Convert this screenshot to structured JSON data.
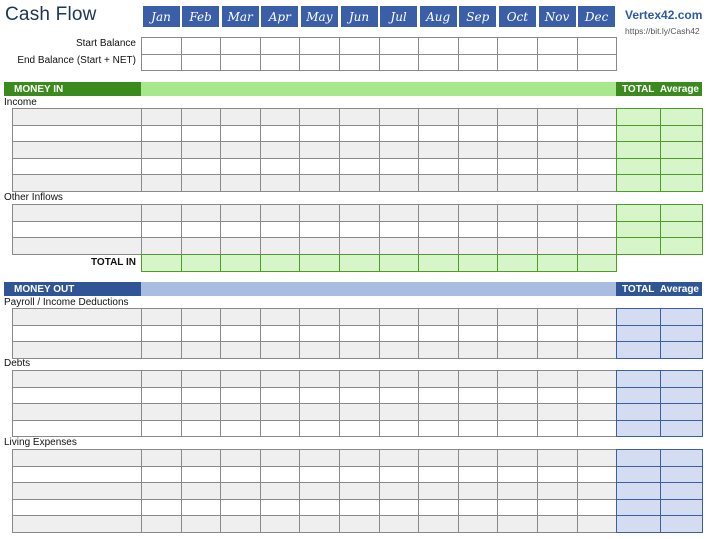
{
  "header": {
    "title": "Cash Flow",
    "months": [
      "Jan",
      "Feb",
      "Mar",
      "Apr",
      "May",
      "Jun",
      "Jul",
      "Aug",
      "Sep",
      "Oct",
      "Nov",
      "Dec"
    ],
    "brand": "Vertex42.com",
    "url": "https://bit.ly/Cash42"
  },
  "balances": {
    "start_label": "Start Balance",
    "end_label": "End Balance (Start + NET)"
  },
  "money_in": {
    "band_label": "MONEY IN",
    "total_label": "TOTAL",
    "average_label": "Average",
    "sections": [
      {
        "label": "Income",
        "rows": 5
      },
      {
        "label": "Other Inflows",
        "rows": 3
      }
    ],
    "total_in_label": "TOTAL IN"
  },
  "money_out": {
    "band_label": "MONEY OUT",
    "total_label": "TOTAL",
    "average_label": "Average",
    "sections": [
      {
        "label": "Payroll / Income Deductions",
        "rows": 3
      },
      {
        "label": "Debts",
        "rows": 4
      },
      {
        "label": "Living Expenses",
        "rows": 5
      }
    ]
  },
  "colors": {
    "month_header": "#3a5ea8",
    "in_dark": "#3b8a1d",
    "in_light": "#a8e88c",
    "in_cell": "#d6f5c9",
    "in_border": "#4e9a2a",
    "out_dark": "#2f5597",
    "out_light": "#a9bde0",
    "out_cell": "#d3dcf0",
    "out_border": "#3a5ea8",
    "shade": "#efefef"
  }
}
